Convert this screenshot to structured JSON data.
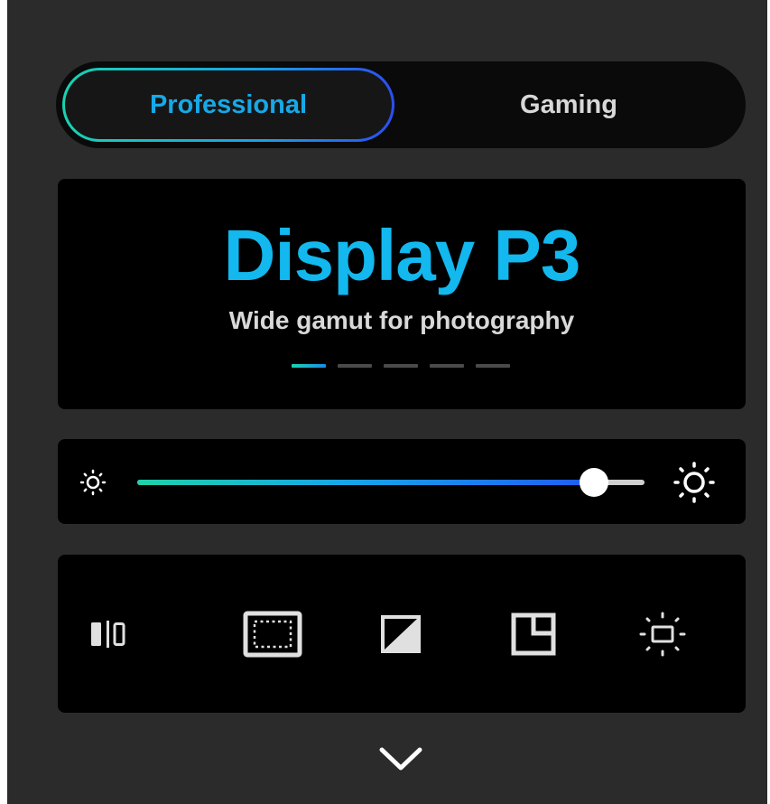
{
  "mode_toggle": {
    "professional_label": "Professional",
    "gaming_label": "Gaming",
    "selected": "Professional"
  },
  "preset": {
    "title": "Display P3",
    "subtitle": "Wide gamut for photography",
    "page_count": 5,
    "active_page": 1
  },
  "brightness": {
    "level_fraction": 0.9,
    "min_icon": "sun-small-icon",
    "max_icon": "sun-large-icon"
  },
  "tools": [
    {
      "name": "split-screen-icon"
    },
    {
      "name": "screen-frame-icon"
    },
    {
      "name": "contrast-icon"
    },
    {
      "name": "window-layout-icon"
    },
    {
      "name": "display-brightness-icon"
    }
  ],
  "footer": {
    "expand_icon": "chevron-down-icon"
  },
  "colors": {
    "accent": "#16a9e8",
    "gradient_start": "#19d3b2",
    "gradient_end": "#2a4ff0",
    "panel_bg": "#2b2b2b",
    "card_bg": "#000000"
  }
}
